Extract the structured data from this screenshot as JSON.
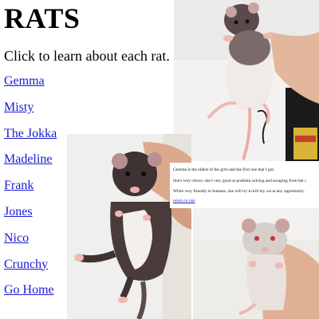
{
  "page": {
    "title": "RATS",
    "intro": "Click to learn about each rat."
  },
  "nav": {
    "items": [
      {
        "label": "Gemma"
      },
      {
        "label": "Misty"
      },
      {
        "label": "The Jokka"
      },
      {
        "label": "Madeline"
      },
      {
        "label": "Frank"
      },
      {
        "label": "Jones"
      },
      {
        "label": "Nico"
      },
      {
        "label": "Crunchy"
      },
      {
        "label": "Go Home"
      }
    ]
  },
  "info_panel": {
    "line1": "Gemma is the oldest of the girls and the first one that I got.",
    "line2": "She's very clever; she's very good at problem solving and escaping from her c",
    "line3": "While very friendly to humans, she will try to kill my cat at any opportunity.",
    "return_link": "return to rats"
  },
  "colors": {
    "link": "#1a1ad6",
    "rat_dark": "#4a3b3b",
    "rat_light": "#e9e2df",
    "skin": "#d9a88c"
  }
}
